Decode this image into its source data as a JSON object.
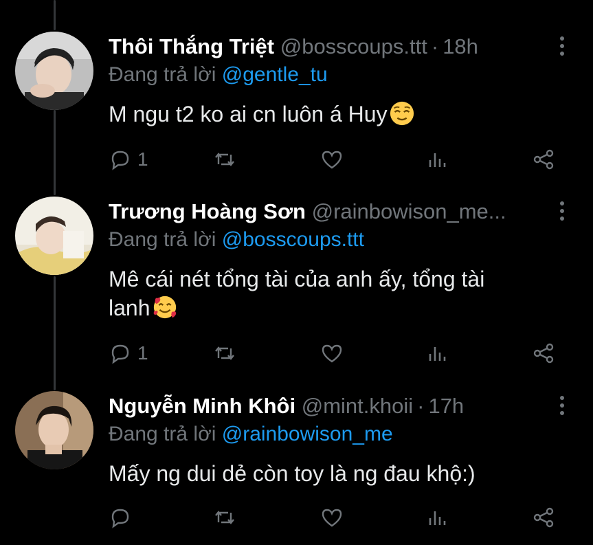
{
  "tweets": [
    {
      "name": "Thôi Thắng Triệt",
      "handle": "@bosscoups.ttt",
      "time": "18h",
      "reply_prefix": "Đang trả lời",
      "reply_to": "@gentle_tu",
      "text": "M ngu t2 ko ai cn luôn á Huy",
      "emoji": "relieved-face-emoji",
      "reply_count": "1",
      "retweet_count": "",
      "like_count": ""
    },
    {
      "name": "Trương Hoàng Sơn",
      "handle": "@rainbowison_me...",
      "time": "",
      "reply_prefix": "Đang trả lời",
      "reply_to": "@bosscoups.ttt",
      "text_line1": "Mê cái nét tổng tài của anh ấy, tổng tài",
      "text_line2": "lanh",
      "emoji": "smiling-face-with-hearts-emoji",
      "reply_count": "1",
      "retweet_count": "",
      "like_count": ""
    },
    {
      "name": "Nguyễn Minh Khôi",
      "handle": "@mint.khoii",
      "time": "17h",
      "reply_prefix": "Đang trả lời",
      "reply_to": "@rainbowison_me",
      "text": "Mấy ng dui dẻ còn toy là ng đau khộ:)",
      "reply_count": "",
      "retweet_count": "",
      "like_count": ""
    }
  ],
  "icons": {
    "reply": "reply-icon",
    "retweet": "retweet-icon",
    "like": "like-icon",
    "views": "views-icon",
    "share": "share-icon",
    "more": "more-icon"
  },
  "colors": {
    "background": "#000000",
    "text": "#e7e9ea",
    "muted": "#71767b",
    "mention": "#1d9bf0",
    "thread_line": "#333639"
  }
}
